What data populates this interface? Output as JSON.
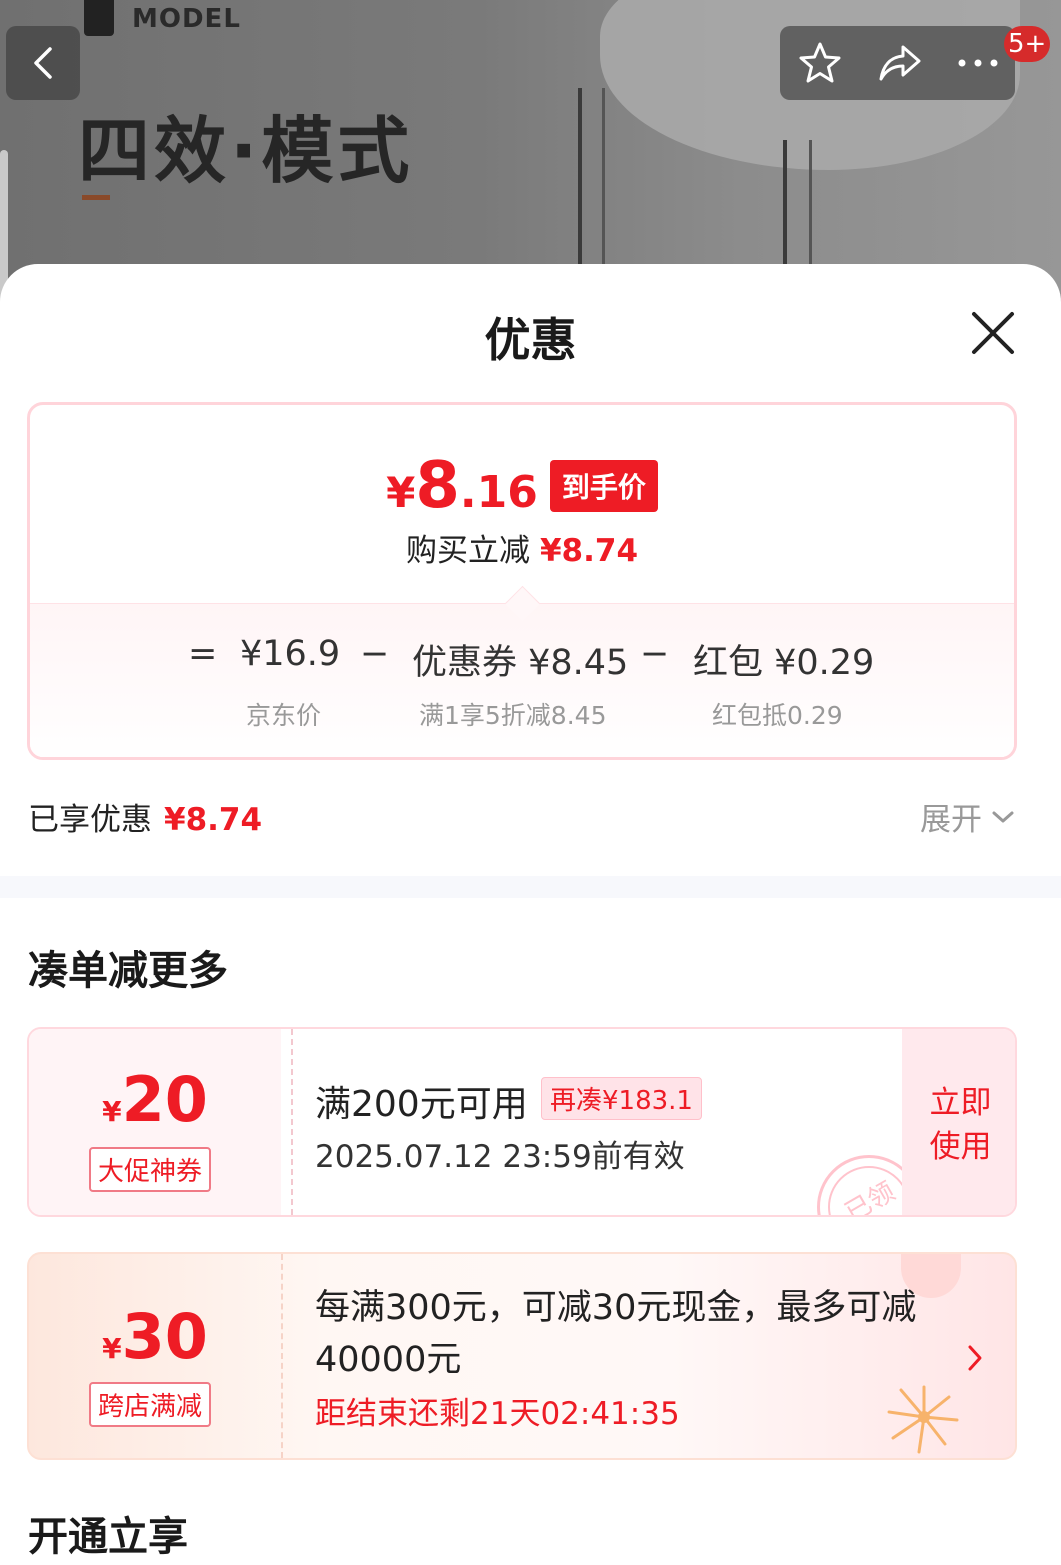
{
  "background": {
    "brand_text": "MODEL",
    "title": "四效·模式"
  },
  "nav": {
    "badge": "5+",
    "icons": [
      "back-icon",
      "star-icon",
      "share-icon",
      "more-icon"
    ]
  },
  "sheet": {
    "title": "优惠",
    "price": {
      "symbol": "¥",
      "integer": "8",
      "decimal": ".16",
      "tag": "到手价",
      "sub_label": "购买立减",
      "sub_value": "¥8.74"
    },
    "formula": {
      "eq": "=",
      "base_value": "¥16.9",
      "minus1": "−",
      "coupon": "优惠券 ¥8.45",
      "minus2": "−",
      "redpacket": "红包 ¥0.29",
      "base_label": "京东价",
      "coupon_label": "满1享5折减8.45",
      "redpacket_label": "红包抵0.29"
    },
    "enjoyed_label": "已享优惠",
    "enjoyed_value": "¥8.74",
    "expand_label": "展开",
    "section_title": "凑单减更多",
    "coupon1": {
      "symbol": "¥",
      "amount": "20",
      "tag": "大促神券",
      "condition": "满200元可用",
      "more": "再凑¥183.1",
      "validity": "2025.07.12 23:59前有效",
      "use_line1": "立即",
      "use_line2": "使用",
      "stamp": "已领"
    },
    "coupon2": {
      "symbol": "¥",
      "amount": "30",
      "tag": "跨店满减",
      "desc": "每满300元，可减30元现金，最多可减40000元",
      "timer": "距结束还剩21天02:41:35"
    },
    "section_title2": "开通立享"
  },
  "colors": {
    "accent": "#ee1c25",
    "badge": "#d62b2b"
  }
}
